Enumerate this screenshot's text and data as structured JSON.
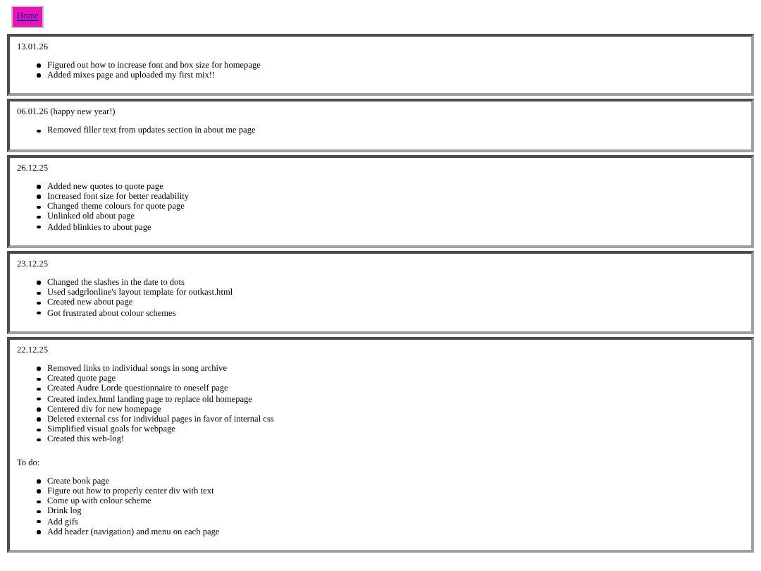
{
  "nav": {
    "home_link": "Home"
  },
  "entries": [
    {
      "heading": "13.01.26",
      "items": [
        "Figured out how to increase font and box size for homepage",
        "Added mixes page and uploaded my first mix!!"
      ]
    },
    {
      "heading": "06.01.26 (happy new year!)",
      "items": [
        "Removed filler text from updates section in about me page"
      ]
    },
    {
      "heading": "26.12.25",
      "items": [
        "Added new quotes to quote page",
        "Increased font size for better readability",
        "Changed theme colours for quote page",
        "Unlinked old about page",
        "Added blinkies to about page"
      ]
    },
    {
      "heading": "23.12.25",
      "items": [
        "Changed the slashes in the date to dots",
        "Used sadgrlonline's layout template for outkast.html",
        "Created new about page",
        "Got frustrated about colour schemes"
      ]
    },
    {
      "heading": "22.12.25",
      "items": [
        "Removed links to individual songs in song archive",
        "Created quote page",
        "Created Audre Lorde questionnaire to oneself page",
        "Created index.html landing page to replace old homepage",
        "Centered div for new homepage",
        "Deleted external css for individual pages in favor of internal css",
        "Simplified visual goals for webpage",
        "Created this web-log!"
      ],
      "todo": {
        "label": "To do:",
        "items": [
          "Create book page",
          "Figure out how to properly center div with text",
          "Come up with colour scheme",
          "Drink log",
          "Add gifs",
          "Add header (navigation) and menu on each page"
        ]
      }
    }
  ]
}
